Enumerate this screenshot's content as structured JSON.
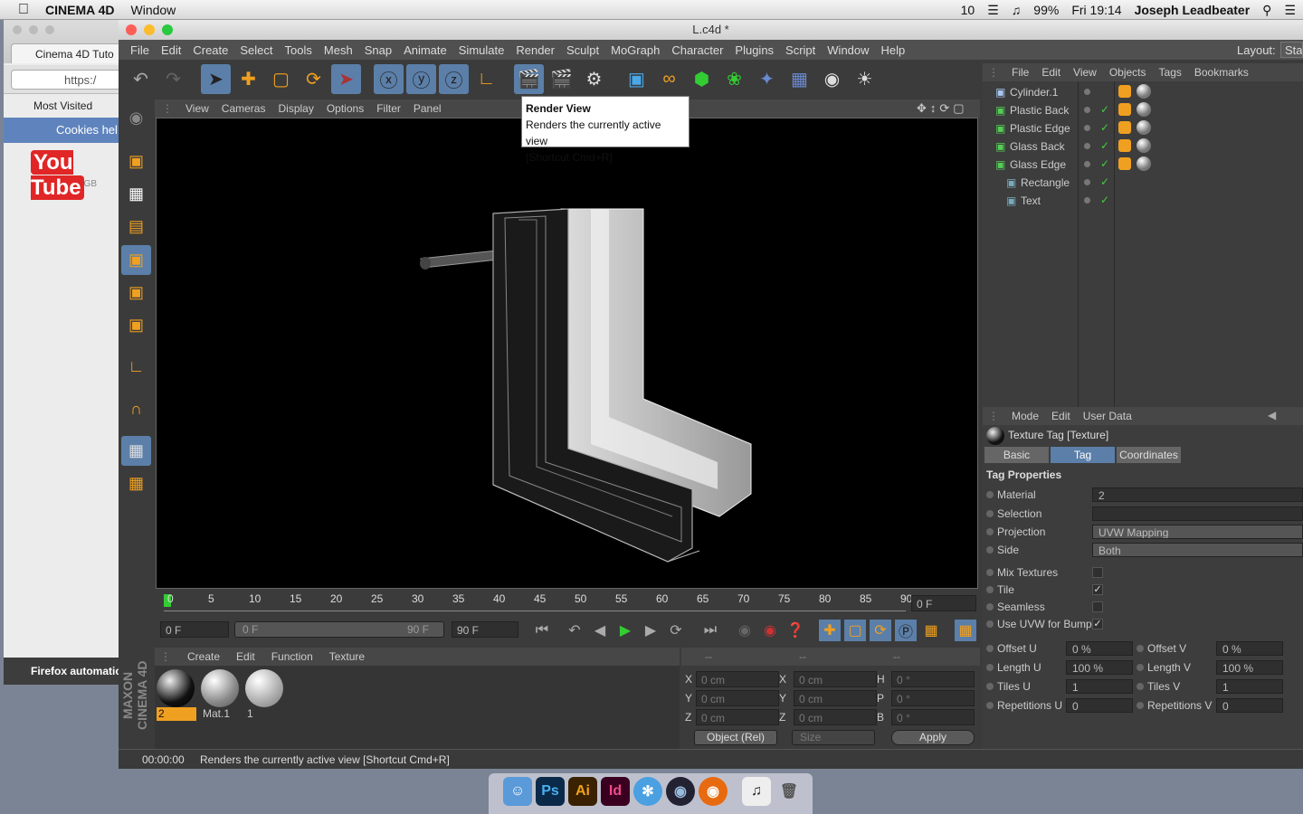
{
  "macmenu": {
    "app": "CINEMA 4D",
    "window": "Window",
    "status": "10",
    "battery": "99%",
    "clock": "Fri 19:14",
    "user": "Joseph Leadbeater"
  },
  "firefox": {
    "tab": "Cinema 4D Tuto",
    "url": "https:/",
    "bookmarks": "Most Visited",
    "notice": "Cookies hel",
    "yt": "You Tube",
    "yt_region": "GB",
    "bottombar": "Firefox automatic"
  },
  "c4d": {
    "title": "L.c4d *",
    "menu": [
      "File",
      "Edit",
      "Create",
      "Select",
      "Tools",
      "Mesh",
      "Snap",
      "Animate",
      "Simulate",
      "Render",
      "Sculpt",
      "MoGraph",
      "Character",
      "Plugins",
      "Script",
      "Window",
      "Help"
    ],
    "layout_label": "Layout:",
    "layout_value": "Star",
    "viewport_menu": [
      "View",
      "Cameras",
      "Display",
      "Options",
      "Filter",
      "Panel"
    ],
    "tooltip": {
      "title": "Render View",
      "desc": "Renders the currently active view",
      "shortcut": "[Shortcut Cmd+R]"
    },
    "ticks": [
      "0",
      "5",
      "10",
      "15",
      "20",
      "25",
      "30",
      "35",
      "40",
      "45",
      "50",
      "55",
      "60",
      "65",
      "70",
      "75",
      "80",
      "85",
      "90"
    ],
    "current_frame": "0 F",
    "transport": {
      "start": "0 F",
      "range_left": "0 F",
      "range_right": "90 F",
      "end": "90 F"
    },
    "material_menu": [
      "Create",
      "Edit",
      "Function",
      "Texture"
    ],
    "materials": [
      {
        "name": "2"
      },
      {
        "name": "Mat.1"
      },
      {
        "name": "1"
      }
    ],
    "coord": {
      "header": [
        "--",
        "--",
        "--"
      ],
      "rows": [
        [
          "X",
          "0 cm",
          "X",
          "0 cm",
          "H",
          "0 °"
        ],
        [
          "Y",
          "0 cm",
          "Y",
          "0 cm",
          "P",
          "0 °"
        ],
        [
          "Z",
          "0 cm",
          "Z",
          "0 cm",
          "B",
          "0 °"
        ]
      ],
      "mode": "Object (Rel)",
      "size": "Size",
      "apply": "Apply"
    },
    "status": {
      "time": "00:00:00",
      "message": "Renders the currently active view [Shortcut Cmd+R]"
    },
    "maxon": "MAXON CINEMA 4D"
  },
  "objects": {
    "menu": [
      "File",
      "Edit",
      "View",
      "Objects",
      "Tags",
      "Bookmarks"
    ],
    "items": [
      {
        "name": "Cylinder.1"
      },
      {
        "name": "Plastic Back"
      },
      {
        "name": "Plastic Edge"
      },
      {
        "name": "Glass Back"
      },
      {
        "name": "Glass Edge"
      },
      {
        "name": "Rectangle"
      },
      {
        "name": "Text"
      }
    ]
  },
  "attributes": {
    "menu": [
      "Mode",
      "Edit",
      "User Data"
    ],
    "title": "Texture Tag [Texture]",
    "tabs": [
      "Basic",
      "Tag",
      "Coordinates"
    ],
    "section": "Tag Properties",
    "props": [
      {
        "label": "Material",
        "value": "2"
      },
      {
        "label": "Selection",
        "value": ""
      },
      {
        "label": "Projection",
        "value": "UVW Mapping"
      },
      {
        "label": "Side",
        "value": "Both"
      }
    ],
    "checks": [
      {
        "label": "Mix Textures",
        "checked": false
      },
      {
        "label": "Tile",
        "checked": true
      },
      {
        "label": "Seamless",
        "checked": false
      },
      {
        "label": "Use UVW for Bump",
        "checked": true
      }
    ],
    "pairs": [
      {
        "l": "Offset U",
        "v": "0 %",
        "l2": "Offset V",
        "v2": "0 %"
      },
      {
        "l": "Length U",
        "v": "100 %",
        "l2": "Length V",
        "v2": "100 %"
      },
      {
        "l": "Tiles U",
        "v": "1",
        "l2": "Tiles V",
        "v2": "1"
      },
      {
        "l": "Repetitions U",
        "v": "0",
        "l2": "Repetitions V",
        "v2": "0"
      }
    ]
  },
  "dock": [
    "Finder",
    "Ps",
    "Ai",
    "Id",
    "Safari",
    "Cinema 4D",
    "Firefox",
    "iTunes",
    "Trash"
  ]
}
